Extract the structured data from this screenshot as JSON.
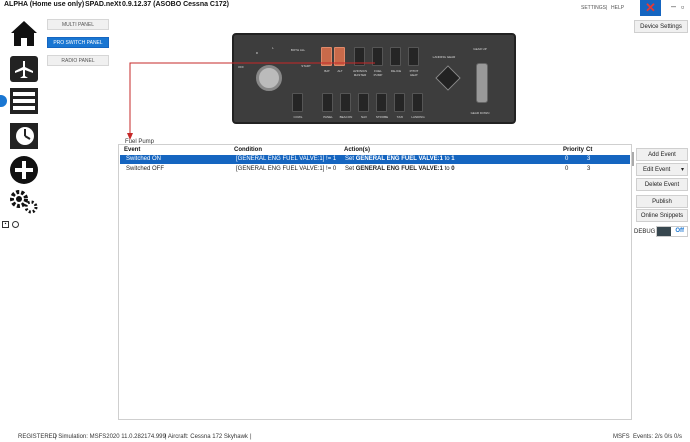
{
  "app": {
    "title": "ALPHA (Home use only)",
    "name": "SPAD.neXt",
    "version": "0.9.12.37 (ASOBO Cessna C172)",
    "settings_link": "SETTINGS",
    "help_link": "HELP",
    "separator": "|"
  },
  "panel_tabs": [
    {
      "label": "MULTI PANEL"
    },
    {
      "label": "PRO SWITCH PANEL"
    },
    {
      "label": "RADIO PANEL"
    }
  ],
  "device": {
    "labels": {
      "magneto_off": "OFF",
      "magneto_r": "R",
      "magneto_l": "L",
      "magneto_both": "BOTH ALL",
      "magneto_start": "START",
      "landing_gear": "LANDING GEAR",
      "gear_up": "GEAR UP",
      "gear_down": "GEAR DOWN",
      "top_switches": [
        "BAT",
        "ALT",
        "AVIONICS MASTER",
        "FUEL PUMP",
        "DE-ICE",
        "PITOT HEAT"
      ],
      "bottom_switches": [
        "COWL",
        "PANEL",
        "BEACON",
        "NAV",
        "STROBE",
        "TAXI",
        "LANDING"
      ]
    }
  },
  "section_label": "Fuel Pump",
  "table": {
    "headers": {
      "event": "Event",
      "condition": "Condition",
      "actions": "Action(s)",
      "priority": "Priority",
      "ct": "Ct"
    },
    "rows": [
      {
        "event": "Switched ON",
        "condition": "[GENERAL ENG FUEL VALVE:1] != 1",
        "action_prefix": "Set",
        "action_bold": "GENERAL ENG FUEL VALVE:1",
        "action_mid": "to",
        "action_value": "1",
        "priority": "0",
        "ct": "3"
      },
      {
        "event": "Switched OFF",
        "condition": "[GENERAL ENG FUEL VALVE:1] != 0",
        "action_prefix": "Set",
        "action_bold": "GENERAL ENG FUEL VALVE:1",
        "action_mid": "to",
        "action_value": "0",
        "priority": "0",
        "ct": "3"
      }
    ]
  },
  "side_buttons": {
    "device_settings": "Device Settings",
    "add_event": "Add Event",
    "edit_event": "Edit Event",
    "edit_event_arrow": "▾",
    "delete_event": "Delete Event",
    "publish": "Publish",
    "online_snippets": "Online Snippets",
    "debug_label": "DEBUG",
    "debug_state": "Off"
  },
  "status": {
    "registered": "REGISTERED",
    "simulation": "| Simulation: MSFS2020 11.0.282174.999",
    "aircraft": "| Aircraft: Cessna 172 Skyhawk",
    "sep": "|",
    "sim_short": "MSFS",
    "events": "Events: 2/s 0/s 0/s"
  },
  "colors": {
    "accent": "#1976d2",
    "selected_row": "#1565c0",
    "annotation": "#c62828",
    "switch_highlight": "#c86a4a"
  }
}
